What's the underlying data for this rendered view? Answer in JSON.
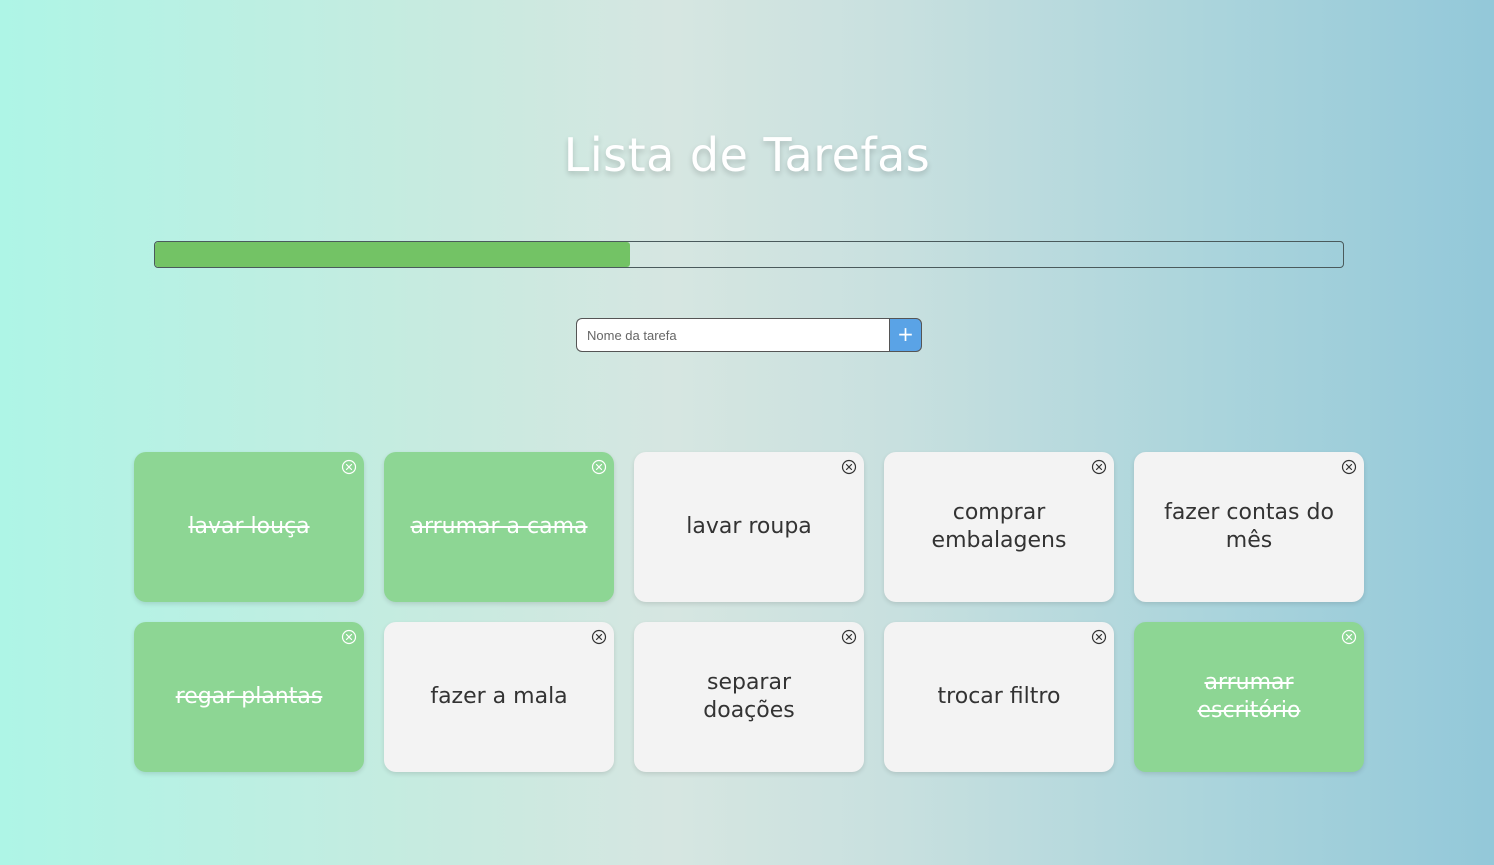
{
  "header": {
    "title": "Lista de Tarefas"
  },
  "progress": {
    "completed_fraction": 0.4
  },
  "add_form": {
    "placeholder": "Nome da tarefa",
    "button_label": "+"
  },
  "colors": {
    "done_card": "#8dd694",
    "pending_card": "#f3f3f3",
    "progress_fill": "#73c365",
    "add_button": "#5aa3e6"
  },
  "icons": {
    "remove": "close-circle-icon"
  },
  "tasks": [
    {
      "label": "lavar louça",
      "done": true
    },
    {
      "label": "arrumar a cama",
      "done": true
    },
    {
      "label": "lavar roupa",
      "done": false
    },
    {
      "label": "comprar embalagens",
      "done": false
    },
    {
      "label": "fazer contas do mês",
      "done": false
    },
    {
      "label": "regar plantas",
      "done": true
    },
    {
      "label": "fazer a mala",
      "done": false
    },
    {
      "label": "separar doações",
      "done": false
    },
    {
      "label": "trocar filtro",
      "done": false
    },
    {
      "label": "arrumar escritório",
      "done": true
    }
  ]
}
